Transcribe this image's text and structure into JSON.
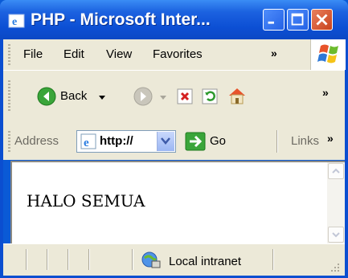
{
  "window": {
    "title": "PHP - Microsoft Inter..."
  },
  "menu": {
    "items": [
      "File",
      "Edit",
      "View",
      "Favorites"
    ],
    "more": "»"
  },
  "toolbar": {
    "back_label": "Back",
    "more": "»"
  },
  "address": {
    "label": "Address",
    "value": "http://",
    "go_label": "Go",
    "links_label": "Links",
    "more": "»"
  },
  "content": {
    "text": "HALO SEMUA"
  },
  "status": {
    "zone": "Local intranet"
  },
  "colors": {
    "titlebar": "#0c4fd4",
    "chrome": "#ece9d8",
    "close": "#c8421c",
    "go_green": "#2f9a2f"
  },
  "icons": [
    "ie-icon",
    "minimize-icon",
    "maximize-icon",
    "close-icon",
    "windows-logo-icon",
    "back-arrow-icon",
    "forward-arrow-icon",
    "stop-icon",
    "refresh-icon",
    "home-icon",
    "go-arrow-icon",
    "intranet-icon",
    "resize-grip-icon"
  ]
}
